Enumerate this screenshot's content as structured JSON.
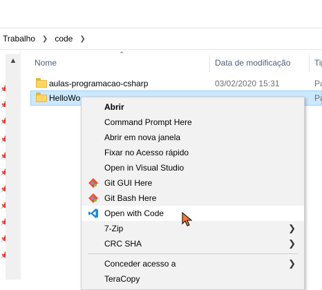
{
  "breadcrumb": [
    "Trabalho",
    "code"
  ],
  "columns": {
    "name": "Nome",
    "date": "Data de modificação",
    "type": "Tip"
  },
  "files": [
    {
      "name": "aulas-programacao-csharp",
      "date": "03/02/2020 15:31",
      "type": "Pa"
    },
    {
      "name": "HelloWo",
      "date": "",
      "type": "Pa"
    }
  ],
  "context_menu": {
    "items": [
      {
        "label": "Abrir",
        "bold": true
      },
      {
        "label": "Command Prompt Here"
      },
      {
        "label": "Abrir em nova janela"
      },
      {
        "label": "Fixar no Acesso rápido"
      },
      {
        "label": "Open in Visual Studio"
      },
      {
        "label": "Git GUI Here",
        "icon": "git-gui-icon"
      },
      {
        "label": "Git Bash Here",
        "icon": "git-bash-icon"
      },
      {
        "label": "Open with Code",
        "icon": "vscode-icon",
        "highlighted": true
      },
      {
        "label": "7-Zip",
        "submenu": true
      },
      {
        "label": "CRC SHA",
        "submenu": true
      },
      {
        "label": "Conceder acesso a",
        "submenu": true
      },
      {
        "label": "TeraCopy"
      }
    ]
  },
  "colors": {
    "selection_bg": "#cce8ff",
    "selection_border": "#99d1ff",
    "menu_bg": "#f2f2f2",
    "header_text": "#4c607a",
    "vscode_blue": "#1f8ad2",
    "git_orange": "#f05033"
  }
}
